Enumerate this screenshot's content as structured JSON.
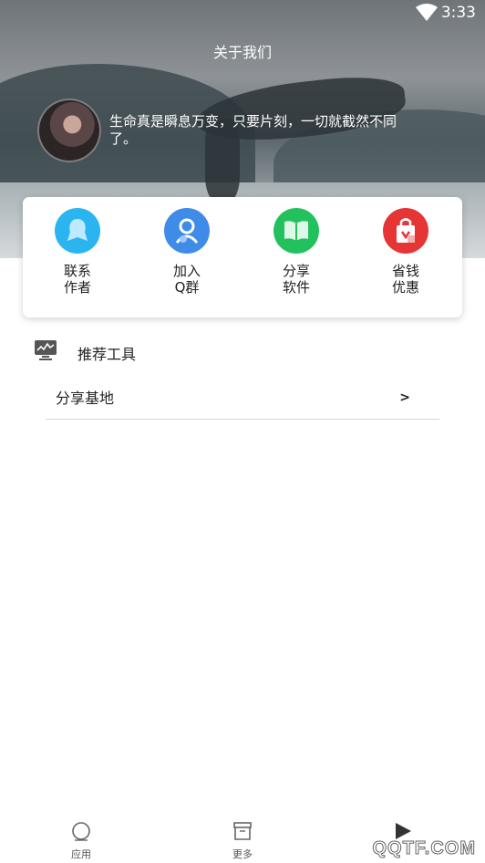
{
  "status_bar": {
    "time": "3:33",
    "wifi_icon": "wifi-icon"
  },
  "header": {
    "title": "关于我们"
  },
  "profile": {
    "motto": "生命真是瞬息万变，只要片刻，一切就截然不同了。"
  },
  "quick_actions": [
    {
      "label": "联系\n作者",
      "icon": "contact-author-icon",
      "color": "#2bb5f0"
    },
    {
      "label": "加入\nQ群",
      "icon": "join-group-icon",
      "color": "#3f8be8"
    },
    {
      "label": "分享\n软件",
      "icon": "share-book-icon",
      "color": "#22c15e"
    },
    {
      "label": "省钱\n优惠",
      "icon": "coupon-bag-icon",
      "color": "#e53535"
    }
  ],
  "section": {
    "title": "推荐工具",
    "icon": "monitor-chart-icon"
  },
  "list": [
    {
      "label": "分享基地",
      "arrow": ">"
    }
  ],
  "tabs": [
    {
      "label": "应用",
      "icon": "circle-icon"
    },
    {
      "label": "更多",
      "icon": "box-icon"
    },
    {
      "label": "",
      "icon": "play-icon"
    }
  ],
  "watermark": "QQTF.COM"
}
